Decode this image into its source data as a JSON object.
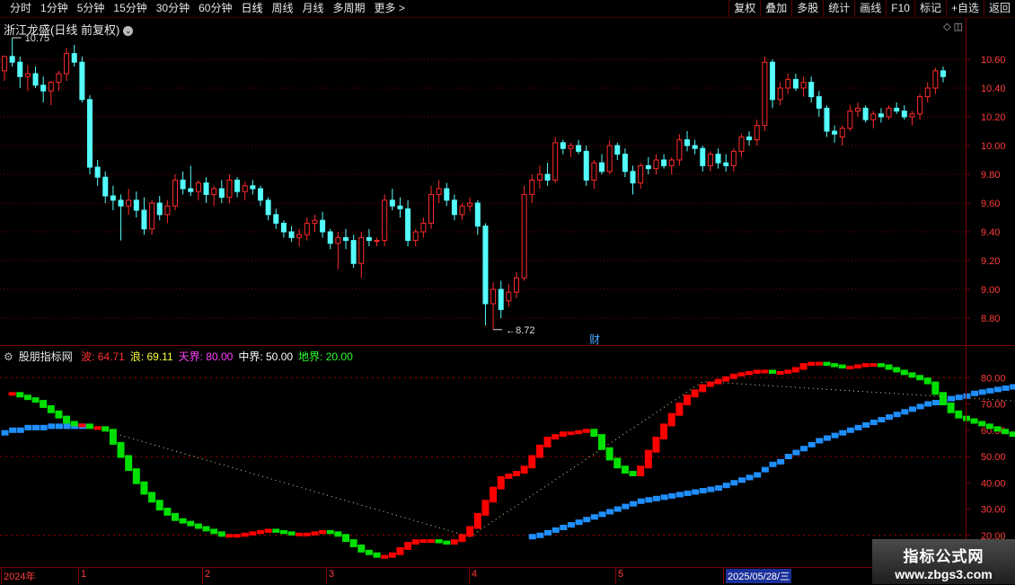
{
  "toolbar": {
    "periods": [
      "分时",
      "1分钟",
      "5分钟",
      "15分钟",
      "30分钟",
      "60分钟",
      "日线",
      "周线",
      "月线",
      "多周期",
      "更多 >"
    ],
    "active_period": "日线",
    "right_buttons": [
      "复权",
      "叠加",
      "多股",
      "统计",
      "画线",
      "F10",
      "标记",
      "+自选",
      "返回"
    ]
  },
  "stock": {
    "title": "浙江龙盛(日线 前复权)",
    "max_label": "10.75",
    "min_label": "8.72",
    "marker": "财"
  },
  "price_axis": {
    "ticks": [
      "10.60",
      "10.40",
      "10.20",
      "10.00",
      "9.80",
      "9.60",
      "9.40",
      "9.20",
      "9.00",
      "8.80"
    ],
    "min": 8.65,
    "max": 10.85
  },
  "indicator": {
    "name": "股朋指标网",
    "items": [
      {
        "label": "波:",
        "value": "64.71",
        "color": "#ff3030"
      },
      {
        "label": "浪:",
        "value": "69.11",
        "color": "#ffff40"
      },
      {
        "label": "天界:",
        "value": "80.00",
        "color": "#ff40ff"
      },
      {
        "label": "中界:",
        "value": "50.00",
        "color": "#ffffff"
      },
      {
        "label": "地界:",
        "value": "20.00",
        "color": "#30ff30"
      }
    ],
    "axis_ticks": [
      "80.00",
      "70.00",
      "60.00",
      "50.00",
      "40.00",
      "30.00",
      "20.00"
    ],
    "min": 10,
    "max": 90,
    "tianjie": 80,
    "zhongjie": 50,
    "dijie": 20
  },
  "date_axis": {
    "labels": [
      "2024年",
      "1",
      "2",
      "3",
      "4",
      "5",
      "2025/05/28/三"
    ],
    "selected": "2025/05/28/三"
  },
  "watermark": {
    "line1": "指标公式网",
    "line2": "www.zbgs3.com"
  },
  "colors": {
    "up": "#ff2a2a",
    "down": "#54fcfc",
    "bo_up": "#ff0000",
    "bo_down": "#00e000",
    "lang": "#1f8fff",
    "grid": "#7a0000"
  },
  "chart_data": {
    "type": "candlestick",
    "candles": [
      {
        "o": 10.52,
        "h": 10.62,
        "l": 10.45,
        "c": 10.62
      },
      {
        "o": 10.62,
        "h": 10.75,
        "l": 10.55,
        "c": 10.58
      },
      {
        "o": 10.58,
        "h": 10.62,
        "l": 10.4,
        "c": 10.48
      },
      {
        "o": 10.48,
        "h": 10.56,
        "l": 10.38,
        "c": 10.5
      },
      {
        "o": 10.5,
        "h": 10.55,
        "l": 10.4,
        "c": 10.42
      },
      {
        "o": 10.42,
        "h": 10.48,
        "l": 10.3,
        "c": 10.38
      },
      {
        "o": 10.38,
        "h": 10.45,
        "l": 10.28,
        "c": 10.44
      },
      {
        "o": 10.44,
        "h": 10.52,
        "l": 10.38,
        "c": 10.5
      },
      {
        "o": 10.5,
        "h": 10.68,
        "l": 10.45,
        "c": 10.64
      },
      {
        "o": 10.64,
        "h": 10.7,
        "l": 10.55,
        "c": 10.58
      },
      {
        "o": 10.58,
        "h": 10.62,
        "l": 10.3,
        "c": 10.32
      },
      {
        "o": 10.32,
        "h": 10.35,
        "l": 9.8,
        "c": 9.85
      },
      {
        "o": 9.85,
        "h": 9.9,
        "l": 9.72,
        "c": 9.78
      },
      {
        "o": 9.78,
        "h": 9.82,
        "l": 9.6,
        "c": 9.65
      },
      {
        "o": 9.65,
        "h": 9.72,
        "l": 9.55,
        "c": 9.62
      },
      {
        "o": 9.62,
        "h": 9.66,
        "l": 9.34,
        "c": 9.58
      },
      {
        "o": 9.58,
        "h": 9.7,
        "l": 9.52,
        "c": 9.62
      },
      {
        "o": 9.62,
        "h": 9.68,
        "l": 9.5,
        "c": 9.55
      },
      {
        "o": 9.55,
        "h": 9.64,
        "l": 9.38,
        "c": 9.42
      },
      {
        "o": 9.42,
        "h": 9.62,
        "l": 9.38,
        "c": 9.6
      },
      {
        "o": 9.6,
        "h": 9.65,
        "l": 9.48,
        "c": 9.52
      },
      {
        "o": 9.52,
        "h": 9.62,
        "l": 9.46,
        "c": 9.58
      },
      {
        "o": 9.58,
        "h": 9.8,
        "l": 9.55,
        "c": 9.76
      },
      {
        "o": 9.76,
        "h": 9.82,
        "l": 9.66,
        "c": 9.7
      },
      {
        "o": 9.7,
        "h": 9.86,
        "l": 9.65,
        "c": 9.68
      },
      {
        "o": 9.68,
        "h": 9.76,
        "l": 9.62,
        "c": 9.74
      },
      {
        "o": 9.74,
        "h": 9.78,
        "l": 9.6,
        "c": 9.66
      },
      {
        "o": 9.66,
        "h": 9.72,
        "l": 9.58,
        "c": 9.7
      },
      {
        "o": 9.7,
        "h": 9.76,
        "l": 9.6,
        "c": 9.64
      },
      {
        "o": 9.64,
        "h": 9.8,
        "l": 9.6,
        "c": 9.76
      },
      {
        "o": 9.76,
        "h": 9.78,
        "l": 9.64,
        "c": 9.68
      },
      {
        "o": 9.68,
        "h": 9.75,
        "l": 9.62,
        "c": 9.72
      },
      {
        "o": 9.72,
        "h": 9.76,
        "l": 9.66,
        "c": 9.7
      },
      {
        "o": 9.7,
        "h": 9.72,
        "l": 9.58,
        "c": 9.62
      },
      {
        "o": 9.62,
        "h": 9.64,
        "l": 9.48,
        "c": 9.52
      },
      {
        "o": 9.52,
        "h": 9.56,
        "l": 9.42,
        "c": 9.46
      },
      {
        "o": 9.46,
        "h": 9.48,
        "l": 9.36,
        "c": 9.4
      },
      {
        "o": 9.4,
        "h": 9.44,
        "l": 9.33,
        "c": 9.36
      },
      {
        "o": 9.36,
        "h": 9.42,
        "l": 9.3,
        "c": 9.38
      },
      {
        "o": 9.38,
        "h": 9.5,
        "l": 9.34,
        "c": 9.46
      },
      {
        "o": 9.46,
        "h": 9.52,
        "l": 9.4,
        "c": 9.48
      },
      {
        "o": 9.48,
        "h": 9.54,
        "l": 9.36,
        "c": 9.4
      },
      {
        "o": 9.4,
        "h": 9.42,
        "l": 9.28,
        "c": 9.32
      },
      {
        "o": 9.32,
        "h": 9.4,
        "l": 9.14,
        "c": 9.36
      },
      {
        "o": 9.36,
        "h": 9.42,
        "l": 9.28,
        "c": 9.34
      },
      {
        "o": 9.34,
        "h": 9.38,
        "l": 9.15,
        "c": 9.18
      },
      {
        "o": 9.18,
        "h": 9.4,
        "l": 9.08,
        "c": 9.36
      },
      {
        "o": 9.36,
        "h": 9.42,
        "l": 9.3,
        "c": 9.34
      },
      {
        "o": 9.34,
        "h": 9.36,
        "l": 9.3,
        "c": 9.34
      },
      {
        "o": 9.34,
        "h": 9.66,
        "l": 9.3,
        "c": 9.62
      },
      {
        "o": 9.62,
        "h": 9.7,
        "l": 9.55,
        "c": 9.58
      },
      {
        "o": 9.58,
        "h": 9.64,
        "l": 9.5,
        "c": 9.56
      },
      {
        "o": 9.56,
        "h": 9.62,
        "l": 9.3,
        "c": 9.34
      },
      {
        "o": 9.34,
        "h": 9.42,
        "l": 9.3,
        "c": 9.4
      },
      {
        "o": 9.4,
        "h": 9.5,
        "l": 9.36,
        "c": 9.46
      },
      {
        "o": 9.46,
        "h": 9.72,
        "l": 9.42,
        "c": 9.66
      },
      {
        "o": 9.66,
        "h": 9.76,
        "l": 9.6,
        "c": 9.7
      },
      {
        "o": 9.7,
        "h": 9.74,
        "l": 9.58,
        "c": 9.62
      },
      {
        "o": 9.62,
        "h": 9.66,
        "l": 9.48,
        "c": 9.52
      },
      {
        "o": 9.52,
        "h": 9.6,
        "l": 9.48,
        "c": 9.58
      },
      {
        "o": 9.58,
        "h": 9.64,
        "l": 9.54,
        "c": 9.6
      },
      {
        "o": 9.6,
        "h": 9.62,
        "l": 9.38,
        "c": 9.44
      },
      {
        "o": 9.44,
        "h": 9.46,
        "l": 8.75,
        "c": 8.9
      },
      {
        "o": 8.9,
        "h": 9.05,
        "l": 8.72,
        "c": 9.0
      },
      {
        "o": 9.0,
        "h": 9.06,
        "l": 8.8,
        "c": 8.86
      },
      {
        "o": 8.92,
        "h": 9.04,
        "l": 8.88,
        "c": 8.98
      },
      {
        "o": 8.98,
        "h": 9.12,
        "l": 8.94,
        "c": 9.08
      },
      {
        "o": 9.08,
        "h": 9.72,
        "l": 9.06,
        "c": 9.66
      },
      {
        "o": 9.66,
        "h": 9.8,
        "l": 9.6,
        "c": 9.76
      },
      {
        "o": 9.76,
        "h": 9.86,
        "l": 9.7,
        "c": 9.8
      },
      {
        "o": 9.8,
        "h": 9.88,
        "l": 9.72,
        "c": 9.76
      },
      {
        "o": 9.76,
        "h": 10.06,
        "l": 9.74,
        "c": 10.02
      },
      {
        "o": 10.02,
        "h": 10.04,
        "l": 9.94,
        "c": 9.98
      },
      {
        "o": 9.98,
        "h": 10.02,
        "l": 9.92,
        "c": 10.0
      },
      {
        "o": 10.0,
        "h": 10.04,
        "l": 9.94,
        "c": 9.96
      },
      {
        "o": 9.96,
        "h": 10.0,
        "l": 9.72,
        "c": 9.76
      },
      {
        "o": 9.76,
        "h": 9.9,
        "l": 9.7,
        "c": 9.88
      },
      {
        "o": 9.88,
        "h": 9.94,
        "l": 9.8,
        "c": 9.82
      },
      {
        "o": 9.82,
        "h": 10.04,
        "l": 9.8,
        "c": 10.0
      },
      {
        "o": 10.0,
        "h": 10.02,
        "l": 9.9,
        "c": 9.94
      },
      {
        "o": 9.94,
        "h": 9.98,
        "l": 9.78,
        "c": 9.82
      },
      {
        "o": 9.82,
        "h": 9.86,
        "l": 9.66,
        "c": 9.74
      },
      {
        "o": 9.74,
        "h": 9.88,
        "l": 9.7,
        "c": 9.86
      },
      {
        "o": 9.86,
        "h": 9.92,
        "l": 9.8,
        "c": 9.84
      },
      {
        "o": 9.84,
        "h": 9.94,
        "l": 9.8,
        "c": 9.9
      },
      {
        "o": 9.9,
        "h": 9.94,
        "l": 9.84,
        "c": 9.86
      },
      {
        "o": 9.86,
        "h": 9.92,
        "l": 9.8,
        "c": 9.9
      },
      {
        "o": 9.9,
        "h": 10.08,
        "l": 9.86,
        "c": 10.04
      },
      {
        "o": 10.04,
        "h": 10.1,
        "l": 9.96,
        "c": 10.0
      },
      {
        "o": 10.0,
        "h": 10.04,
        "l": 9.94,
        "c": 9.98
      },
      {
        "o": 9.98,
        "h": 10.0,
        "l": 9.82,
        "c": 9.86
      },
      {
        "o": 9.86,
        "h": 9.96,
        "l": 9.82,
        "c": 9.94
      },
      {
        "o": 9.94,
        "h": 9.98,
        "l": 9.84,
        "c": 9.88
      },
      {
        "o": 9.88,
        "h": 9.94,
        "l": 9.82,
        "c": 9.86
      },
      {
        "o": 9.86,
        "h": 9.98,
        "l": 9.82,
        "c": 9.96
      },
      {
        "o": 9.96,
        "h": 10.08,
        "l": 9.92,
        "c": 10.06
      },
      {
        "o": 10.06,
        "h": 10.1,
        "l": 10.0,
        "c": 10.04
      },
      {
        "o": 10.04,
        "h": 10.18,
        "l": 10.0,
        "c": 10.14
      },
      {
        "o": 10.14,
        "h": 10.62,
        "l": 10.1,
        "c": 10.58
      },
      {
        "o": 10.58,
        "h": 10.6,
        "l": 10.26,
        "c": 10.32
      },
      {
        "o": 10.32,
        "h": 10.44,
        "l": 10.28,
        "c": 10.4
      },
      {
        "o": 10.4,
        "h": 10.5,
        "l": 10.36,
        "c": 10.46
      },
      {
        "o": 10.46,
        "h": 10.5,
        "l": 10.38,
        "c": 10.4
      },
      {
        "o": 10.4,
        "h": 10.48,
        "l": 10.34,
        "c": 10.44
      },
      {
        "o": 10.44,
        "h": 10.48,
        "l": 10.3,
        "c": 10.34
      },
      {
        "o": 10.34,
        "h": 10.38,
        "l": 10.2,
        "c": 10.26
      },
      {
        "o": 10.26,
        "h": 10.28,
        "l": 10.06,
        "c": 10.1
      },
      {
        "o": 10.1,
        "h": 10.14,
        "l": 10.02,
        "c": 10.08
      },
      {
        "o": 10.06,
        "h": 10.14,
        "l": 10.0,
        "c": 10.12
      },
      {
        "o": 10.12,
        "h": 10.28,
        "l": 10.1,
        "c": 10.24
      },
      {
        "o": 10.24,
        "h": 10.3,
        "l": 10.2,
        "c": 10.26
      },
      {
        "o": 10.26,
        "h": 10.28,
        "l": 10.16,
        "c": 10.18
      },
      {
        "o": 10.18,
        "h": 10.24,
        "l": 10.12,
        "c": 10.22
      },
      {
        "o": 10.22,
        "h": 10.26,
        "l": 10.16,
        "c": 10.2
      },
      {
        "o": 10.2,
        "h": 10.28,
        "l": 10.18,
        "c": 10.26
      },
      {
        "o": 10.26,
        "h": 10.3,
        "l": 10.22,
        "c": 10.24
      },
      {
        "o": 10.24,
        "h": 10.28,
        "l": 10.18,
        "c": 10.2
      },
      {
        "o": 10.2,
        "h": 10.24,
        "l": 10.14,
        "c": 10.22
      },
      {
        "o": 10.22,
        "h": 10.36,
        "l": 10.18,
        "c": 10.34
      },
      {
        "o": 10.34,
        "h": 10.44,
        "l": 10.3,
        "c": 10.4
      },
      {
        "o": 10.4,
        "h": 10.54,
        "l": 10.36,
        "c": 10.52
      },
      {
        "o": 10.52,
        "h": 10.55,
        "l": 10.44,
        "c": 10.48
      }
    ],
    "bo": [
      74,
      74,
      73,
      72,
      71,
      69,
      67,
      65,
      63,
      62,
      62,
      61,
      61,
      60,
      55,
      50,
      45,
      40,
      36,
      33,
      30,
      28,
      26,
      25,
      24,
      23,
      22,
      21,
      20,
      20,
      20,
      20.5,
      21,
      21.5,
      22,
      21.5,
      21,
      20.5,
      20.5,
      20.5,
      21,
      21.5,
      21,
      20,
      18,
      16,
      14,
      13,
      12,
      12,
      13,
      15,
      17,
      18,
      18,
      18,
      17.5,
      17,
      18,
      20,
      23,
      28,
      33,
      38,
      42,
      43,
      44,
      46,
      50,
      54,
      57,
      58,
      59,
      59,
      59.5,
      60,
      58,
      53,
      49,
      46,
      44,
      43,
      46,
      52,
      57,
      62,
      66,
      70,
      73,
      75,
      77,
      78,
      79,
      80,
      81,
      81.5,
      82,
      82.5,
      82.5,
      82,
      82,
      82.5,
      83.5,
      85,
      85.5,
      85.5,
      85,
      84.5,
      84,
      84,
      84.5,
      85,
      85,
      84.5,
      83.5,
      82.5,
      81.5,
      80.5,
      79.5,
      78,
      74,
      70,
      67,
      65,
      64,
      63,
      62,
      61,
      60,
      59,
      58,
      57,
      57,
      57.5,
      59,
      61,
      64
    ],
    "lang": [
      59,
      60,
      60,
      61,
      61,
      61,
      61.5,
      61.5,
      61.5,
      61.5,
      61.5
    ],
    "lang2_start": 68,
    "lang2": [
      19.5,
      20,
      21,
      22,
      23,
      24,
      25,
      26,
      27,
      28,
      29,
      30,
      31,
      32,
      33,
      33.5,
      34,
      34.5,
      35,
      35.5,
      36,
      36.5,
      37,
      37.5,
      38,
      39,
      40,
      41,
      42,
      43,
      45,
      47,
      48,
      50,
      51.5,
      53,
      54.5,
      56,
      57,
      58,
      59,
      60,
      61,
      62,
      63,
      64,
      65,
      66,
      67,
      68,
      69,
      70,
      70.5,
      71,
      72,
      72.5,
      73,
      74,
      74.5,
      75,
      75.5,
      76,
      76.5,
      77,
      77.5,
      78,
      78.3,
      78.5
    ],
    "dotted_from": 11,
    "dotted_to": 142,
    "dotted_endpoints": [
      [
        11,
        61.5
      ],
      [
        60,
        19.5
      ],
      [
        90,
        78.5
      ],
      [
        142,
        69
      ]
    ]
  }
}
